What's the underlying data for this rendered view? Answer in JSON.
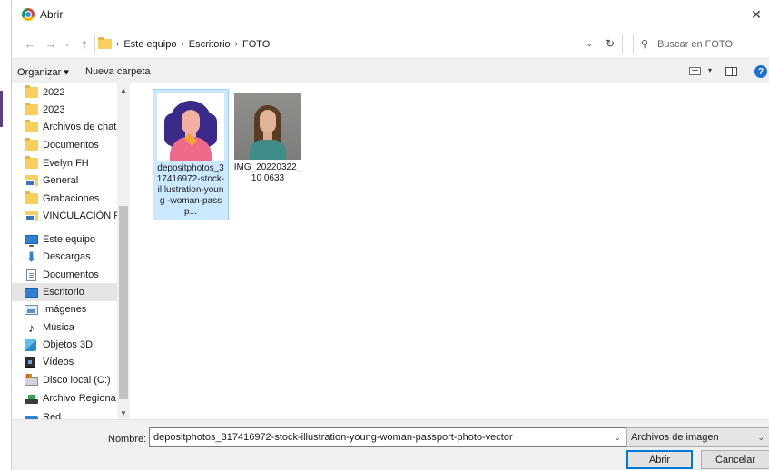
{
  "window": {
    "title": "Abrir",
    "close_glyph": "✕",
    "app_icon": "chrome-icon"
  },
  "nav": {
    "back_glyph": "←",
    "forward_glyph": "→",
    "dropdown_glyph": "⌄",
    "up_glyph": "↑",
    "breadcrumbs": [
      "Este equipo",
      "Escritorio",
      "FOTO"
    ],
    "crumb_separator": "›",
    "address_chevron": "⌄",
    "refresh_glyph": "↻",
    "search_placeholder": "Buscar en FOTO",
    "search_glyph": "⚲"
  },
  "toolbar": {
    "organize_label": "Organizar ▾",
    "new_folder_label": "Nueva carpeta",
    "view_arrow": "▾",
    "help_glyph": "?"
  },
  "sidebar": {
    "scroll_up": "▲",
    "scroll_down": "▼",
    "items": [
      {
        "label": "2022",
        "icon": "folder-icon"
      },
      {
        "label": "2023",
        "icon": "folder-icon"
      },
      {
        "label": "Archivos de chat",
        "icon": "folder-icon"
      },
      {
        "label": "Documentos",
        "icon": "folder-icon"
      },
      {
        "label": "Evelyn FH",
        "icon": "folder-icon"
      },
      {
        "label": "General",
        "icon": "network-folder-icon"
      },
      {
        "label": "Grabaciones",
        "icon": "folder-icon"
      },
      {
        "label": "VINCULACIÓN F",
        "icon": "network-folder-icon"
      },
      {
        "label": "Este equipo",
        "icon": "this-pc-icon"
      },
      {
        "label": "Descargas",
        "icon": "download-icon"
      },
      {
        "label": "Documentos",
        "icon": "document-icon"
      },
      {
        "label": "Escritorio",
        "icon": "desktop-icon",
        "selected": true
      },
      {
        "label": "Imágenes",
        "icon": "images-icon"
      },
      {
        "label": "Música",
        "icon": "music-icon"
      },
      {
        "label": "Objetos 3D",
        "icon": "3d-objects-icon"
      },
      {
        "label": "Vídeos",
        "icon": "videos-icon"
      },
      {
        "label": "Disco local (C:)",
        "icon": "local-disk-icon"
      },
      {
        "label": "Archivo Regiona",
        "icon": "network-drive-icon"
      },
      {
        "label": "Red",
        "icon": "network-icon"
      }
    ]
  },
  "files": [
    {
      "name": "depositphotos_317416972-stock-illustration-young-woman-passport-photo-vector",
      "display_name": "depositphotos_3 17416972-stock-il lustration-young -woman-passp...",
      "selected": true,
      "thumb": "illustration"
    },
    {
      "name": "IMG_20220322_100633",
      "display_name": "IMG_20220322_10 0633",
      "selected": false,
      "thumb": "photo"
    }
  ],
  "bottom": {
    "name_label": "Nombre:",
    "name_value": "depositphotos_317416972-stock-illustration-young-woman-passport-photo-vector",
    "name_chevron": "⌄",
    "file_type": "Archivos de imagen",
    "file_type_chevron": "⌄",
    "open_label": "Abrir",
    "cancel_label": "Cancelar"
  },
  "colors": {
    "selection": "#cce8ff",
    "accent": "#0078d7",
    "help": "#1a6fd6"
  }
}
